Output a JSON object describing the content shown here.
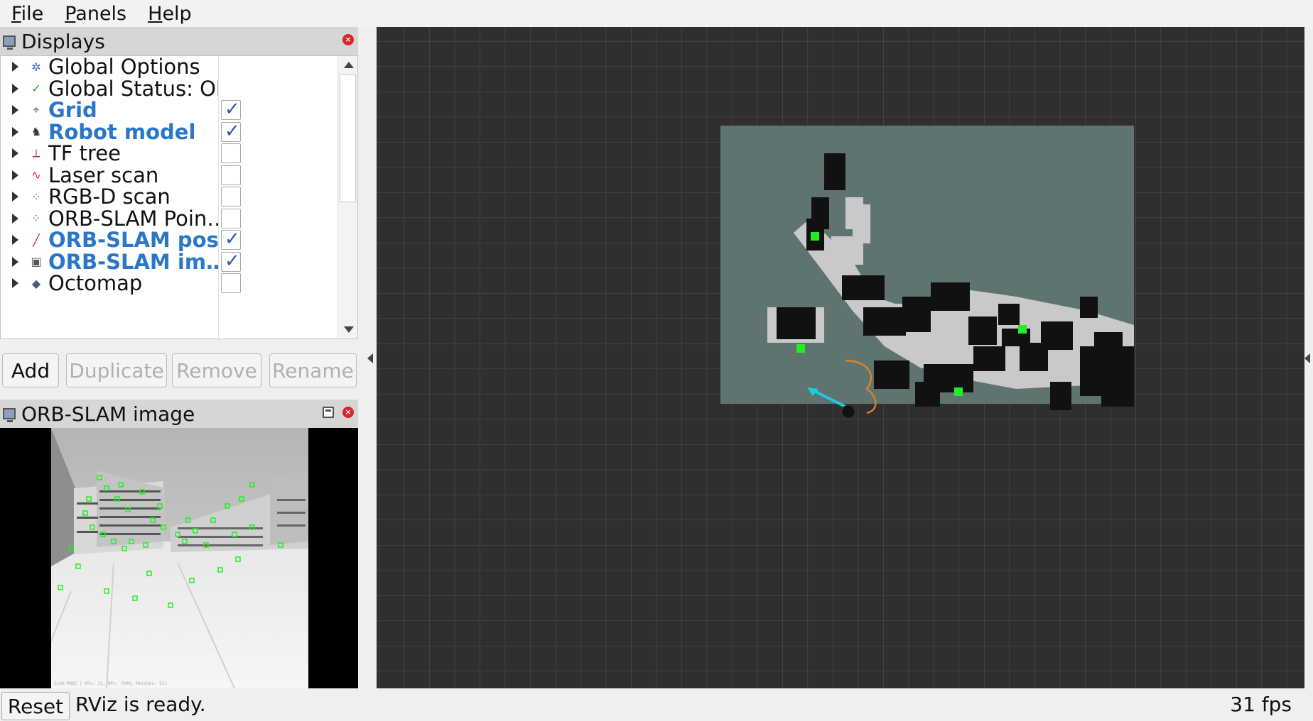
{
  "menu": [
    {
      "label": "File",
      "accel": "F",
      "rest": "ile"
    },
    {
      "label": "Panels",
      "accel": "P",
      "rest": "anels"
    },
    {
      "label": "Help",
      "accel": "H",
      "rest": "elp"
    }
  ],
  "displays": {
    "title": "Displays",
    "items": [
      {
        "label": "Global Options",
        "icon": "gear-icon",
        "glyph": "✲",
        "color": "#3a6fc4",
        "enabled": false,
        "checkbox": false
      },
      {
        "label": "Global Status: Ok",
        "icon": "check-icon",
        "glyph": "✓",
        "color": "#2a9a2a",
        "enabled": false,
        "checkbox": false
      },
      {
        "label": "Grid",
        "icon": "grid-icon",
        "glyph": "⌖",
        "color": "#555",
        "enabled": true,
        "checkbox": true,
        "checked": true
      },
      {
        "label": "Robot model",
        "icon": "robot-icon",
        "glyph": "♞",
        "color": "#333",
        "enabled": true,
        "checkbox": true,
        "checked": true
      },
      {
        "label": "TF tree",
        "icon": "tf-axes-icon",
        "glyph": "⟂",
        "color": "#c03030",
        "enabled": false,
        "checkbox": true,
        "checked": false
      },
      {
        "label": "Laser scan",
        "icon": "laser-scan-icon",
        "glyph": "∿",
        "color": "#d02020",
        "enabled": false,
        "checkbox": true,
        "checked": false
      },
      {
        "label": "RGB-D scan",
        "icon": "point-cloud-icon",
        "glyph": "⁘",
        "color": "#3a6fc4",
        "enabled": false,
        "checkbox": true,
        "checked": false
      },
      {
        "label": "ORB-SLAM Poin…",
        "icon": "point-cloud-icon",
        "glyph": "⁘",
        "color": "#3a6fc4",
        "enabled": false,
        "checkbox": true,
        "checked": false
      },
      {
        "label": "ORB-SLAM pose",
        "icon": "pose-arrow-icon",
        "glyph": "╱",
        "color": "#d02020",
        "enabled": true,
        "checkbox": true,
        "checked": true
      },
      {
        "label": "ORB-SLAM im…",
        "icon": "image-icon",
        "glyph": "▣",
        "color": "#555",
        "enabled": true,
        "checkbox": true,
        "checked": true
      },
      {
        "label": "Octomap",
        "icon": "octomap-icon",
        "glyph": "◆",
        "color": "#4a5a80",
        "enabled": false,
        "checkbox": true,
        "checked": false
      }
    ],
    "buttons": {
      "add": "Add",
      "duplicate": "Duplicate",
      "remove": "Remove",
      "rename": "Rename"
    }
  },
  "image_panel": {
    "title": "ORB-SLAM image",
    "overlay_text": "SLAM MODE | KFs: 31, MPs: 7009, Matches: 511"
  },
  "status": {
    "reset": "Reset",
    "message": "RViz is ready.",
    "fps": "31 fps"
  },
  "colors": {
    "grid_bg": "#2f2f2f",
    "map_unknown": "#5f7471",
    "map_free": "#c9c9c9",
    "map_occupied": "#111111",
    "feature": "#22ee22",
    "pose_arrow": "#20c8d8",
    "path": "#d9822b"
  }
}
